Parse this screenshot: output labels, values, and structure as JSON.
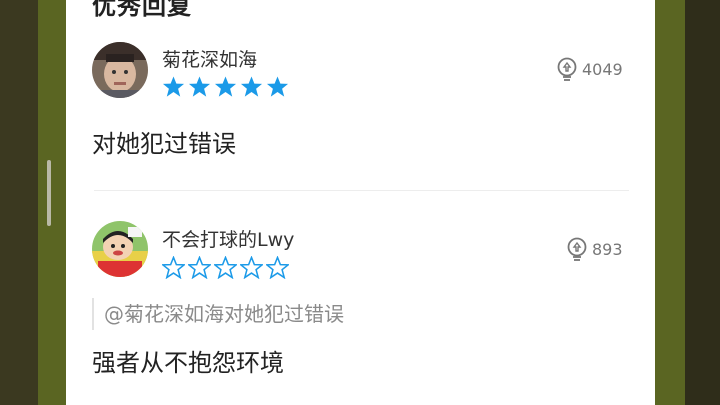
{
  "section": {
    "title": "优秀回复"
  },
  "comments": [
    {
      "username": "菊花深如海",
      "rating": 5,
      "likes": "4049",
      "text": "对她犯过错误"
    },
    {
      "username": "不会打球的Lwy",
      "rating": 0,
      "likes": "893",
      "quote": "@菊花深如海对她犯过错误",
      "text": "强者从不抱怨环境"
    }
  ],
  "colors": {
    "star_blue": "#1b9ae8",
    "olive_frame": "#5a6522"
  },
  "icons": {
    "like": "lightbulb-like-icon",
    "star_filled": "filled-star-icon",
    "star_empty": "outline-star-icon"
  }
}
